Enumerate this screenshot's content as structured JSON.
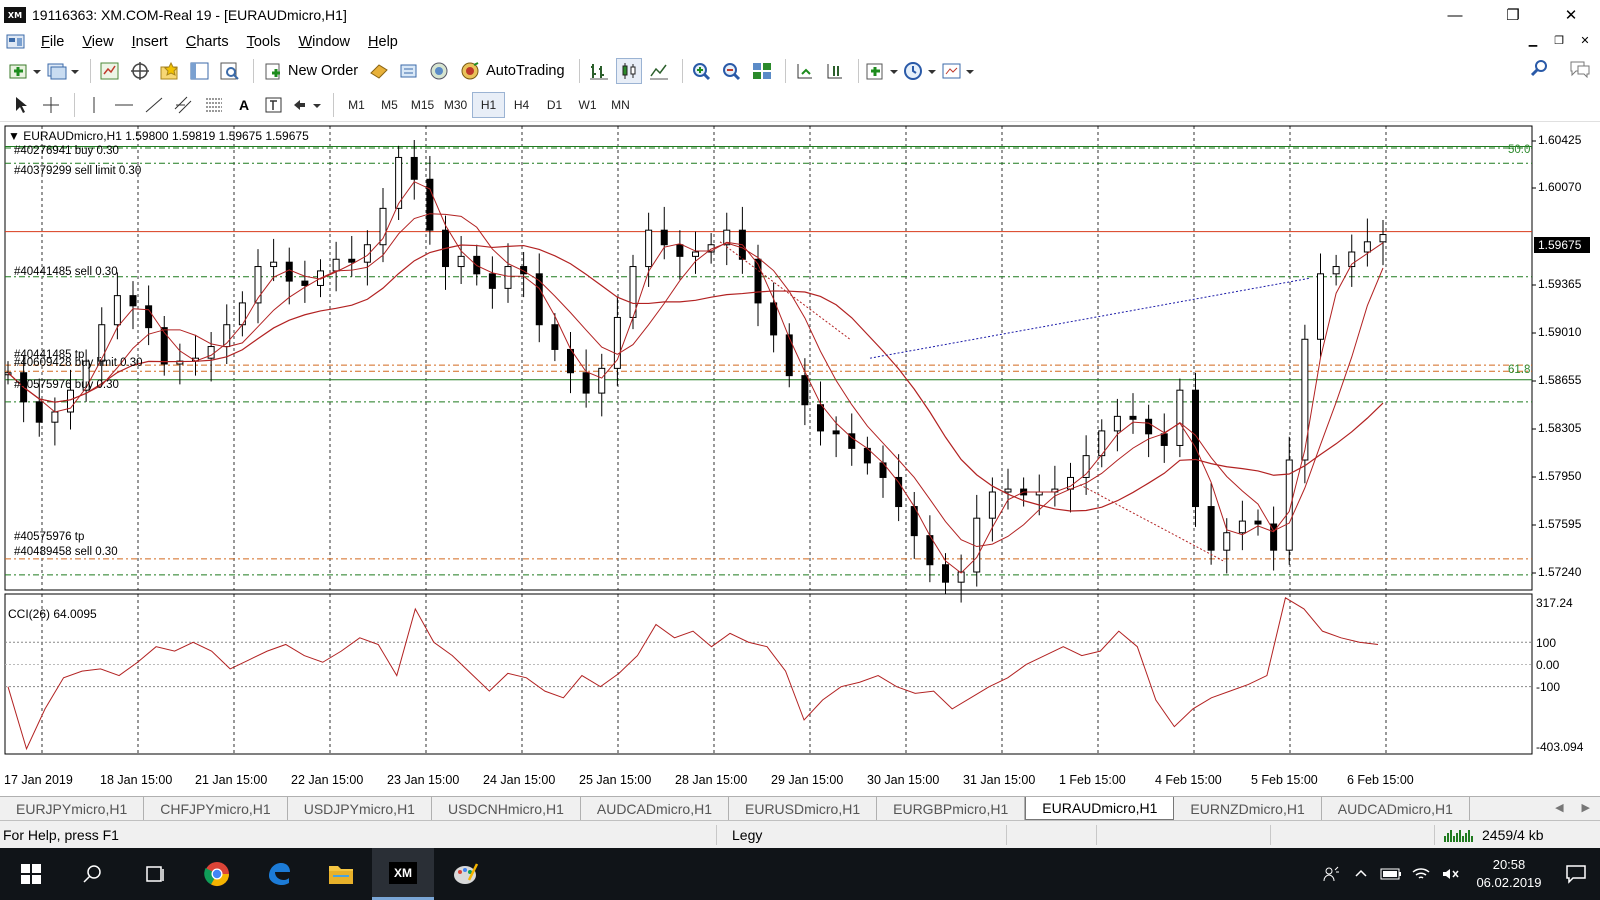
{
  "window": {
    "title": "19116363: XM.COM-Real 19 - [EURAUDmicro,H1]",
    "logo": "XM",
    "minimize": "—",
    "maximize": "❐",
    "close": "✕"
  },
  "menu": {
    "items": [
      "File",
      "View",
      "Insert",
      "Charts",
      "Tools",
      "Window",
      "Help"
    ],
    "underline": [
      "F",
      "V",
      "I",
      "C",
      "T",
      "W",
      "H"
    ]
  },
  "toolbar": {
    "new_order": "New Order",
    "autotrading": "AutoTrading"
  },
  "timeframes": [
    "M1",
    "M5",
    "M15",
    "M30",
    "H1",
    "H4",
    "D1",
    "W1",
    "MN"
  ],
  "timeframe_active": "H1",
  "chart": {
    "header": "EURAUDmicro,H1  1.59800 1.59819 1.59675 1.59675",
    "current_price": "1.59675",
    "price_scale": [
      "1.60425",
      "1.60070",
      "1.59365",
      "1.59010",
      "1.58655",
      "1.58305",
      "1.57950",
      "1.57595",
      "1.57240"
    ],
    "fib_levels": [
      "50.0",
      "61.8"
    ],
    "orders": [
      "#40276941 buy 0.30",
      "#40379299 sell limit 0.30",
      "#40441485 sell 0.30",
      "#40441485 tp",
      "#40609428 buy limit 0.30",
      "#40575976 buy 0.30",
      "#40575976 tp",
      "#40489458 sell 0.30"
    ],
    "dates": [
      "17 Jan 2019",
      "18 Jan 15:00",
      "21 Jan 15:00",
      "22 Jan 15:00",
      "23 Jan 15:00",
      "24 Jan 15:00",
      "25 Jan 15:00",
      "28 Jan 15:00",
      "29 Jan 15:00",
      "30 Jan 15:00",
      "31 Jan 15:00",
      "1 Feb 15:00",
      "4 Feb 15:00",
      "5 Feb 15:00",
      "6 Feb 15:00"
    ],
    "cci_label": "CCI(26) 64.0095",
    "cci_scale": [
      "317.24",
      "100",
      "0.00",
      "-100",
      "-403.094"
    ],
    "colors": {
      "candle": "#000000",
      "ma": "#b22222",
      "order_green": "#1f7a1f",
      "order_orange": "#d2691e",
      "trend_blue": "#1a1aa8"
    }
  },
  "chart_data": {
    "type": "line",
    "title": "EURAUDmicro,H1",
    "series": [
      {
        "name": "EURAUDmicro,H1",
        "values": [
          1.5872,
          1.5852,
          1.5838,
          1.5845,
          1.586,
          1.588,
          1.5905,
          1.5925,
          1.5918,
          1.5903,
          1.5878,
          1.588,
          1.5882,
          1.589,
          1.5905,
          1.592,
          1.5945,
          1.5948,
          1.5935,
          1.5932,
          1.5942,
          1.595,
          1.5948,
          1.596,
          1.5985,
          1.602,
          1.6005,
          1.597,
          1.5945,
          1.5952,
          1.594,
          1.593,
          1.5945,
          1.594,
          1.5905,
          1.5888,
          1.5872,
          1.5858,
          1.5875,
          1.591,
          1.5945,
          1.597,
          1.596,
          1.5952,
          1.5955,
          1.596,
          1.597,
          1.595,
          1.592,
          1.5898,
          1.587,
          1.585,
          1.5832,
          1.583,
          1.582,
          1.581,
          1.58,
          1.578,
          1.576,
          1.574,
          1.5728,
          1.5735,
          1.5772,
          1.579,
          1.5792,
          1.5788,
          1.579,
          1.5792,
          1.58,
          1.5815,
          1.5832,
          1.5842,
          1.584,
          1.583,
          1.5822,
          1.586,
          1.578,
          1.575,
          1.5762,
          1.577,
          1.5768,
          1.575,
          1.5812,
          1.5895,
          1.594,
          1.5945,
          1.5955,
          1.5962,
          1.5967
        ]
      },
      {
        "name": "CCI(26)",
        "values": [
          -100,
          -380,
          -200,
          -60,
          -30,
          -20,
          -50,
          10,
          80,
          60,
          100,
          60,
          -20,
          20,
          60,
          90,
          40,
          10,
          60,
          120,
          90,
          -50,
          250,
          100,
          40,
          -40,
          -120,
          -40,
          -60,
          -120,
          -150,
          -50,
          -100,
          -40,
          40,
          180,
          120,
          150,
          80,
          140,
          100,
          80,
          -30,
          -250,
          -160,
          -100,
          -80,
          -50,
          -100,
          -130,
          -120,
          -200,
          -150,
          -100,
          -60,
          0,
          40,
          80,
          40,
          60,
          150,
          80,
          -160,
          -280,
          -200,
          -150,
          -120,
          -90,
          -50,
          300,
          250,
          150,
          120,
          100,
          90
        ]
      }
    ],
    "ylim": [
      1.5724,
      1.6043
    ],
    "cci_ylim": [
      -403.094,
      317.24
    ]
  },
  "tabs": {
    "items": [
      "EURJPYmicro,H1",
      "CHFJPYmicro,H1",
      "USDJPYmicro,H1",
      "USDCNHmicro,H1",
      "AUDCADmicro,H1",
      "EURUSDmicro,H1",
      "EURGBPmicro,H1",
      "EURAUDmicro,H1",
      "EURNZDmicro,H1",
      "AUDCADmicro,H1"
    ],
    "active": "EURAUDmicro,H1"
  },
  "status": {
    "help": "For Help, press F1",
    "profile": "Legy",
    "traffic": "2459/4 kb"
  },
  "taskbar": {
    "time": "20:58",
    "date": "06.02.2019"
  }
}
